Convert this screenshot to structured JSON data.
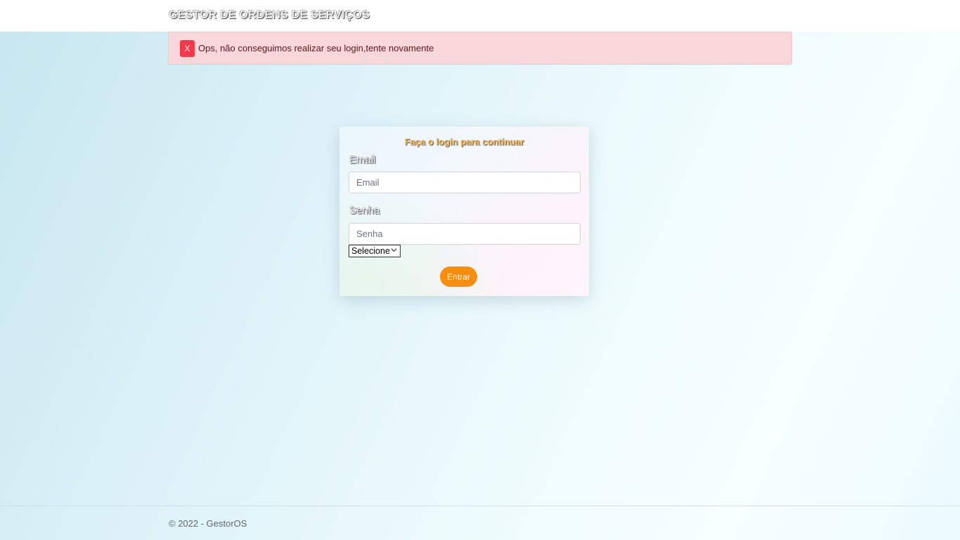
{
  "navbar": {
    "brand": "GESTOR DE ORDENS DE SERVIÇOS"
  },
  "alert": {
    "close_label": "X",
    "message": "Ops, não conseguimos realizar seu login,tente novamente"
  },
  "login": {
    "title": "Faça o login para continuar",
    "email_label": "Email",
    "email_placeholder": "Email",
    "password_label": "Senha",
    "password_placeholder": "Senha",
    "select_value": "Selecione",
    "submit_label": "Entrar"
  },
  "footer": {
    "text": "© 2022 - GestorOS"
  },
  "colors": {
    "accent": "#f78e12",
    "alert_bg": "#f8d7da",
    "alert_close": "#f23a4d",
    "title": "#f4b860"
  }
}
